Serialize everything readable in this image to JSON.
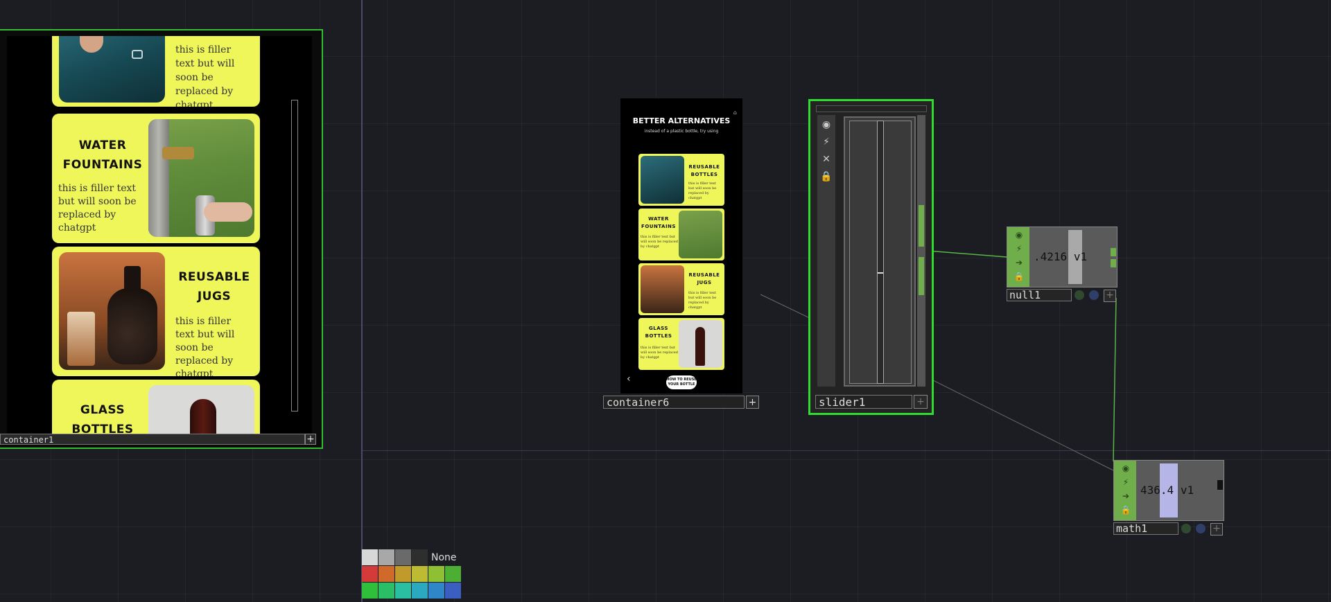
{
  "container1": {
    "label": "container1",
    "cards": [
      {
        "title": "",
        "body": "this is filler text but will soon be replaced by chatgpt"
      },
      {
        "title": "WATER FOUNTAINS",
        "body": "this is filler text but will soon be replaced by chatgpt"
      },
      {
        "title": "REUSABLE JUGS",
        "body": "this is filler text but will soon be replaced by chatgpt"
      },
      {
        "title": "GLASS BOTTLES",
        "body": ""
      }
    ]
  },
  "container6": {
    "label": "container6",
    "heading": "BETTER ALTERNATIVES",
    "subheading": "instead of a plastic bottle, try using",
    "cards": [
      {
        "title": "REUSABLE BOTTLES",
        "body": "this is filler text but will soon be replaced by chatgpt"
      },
      {
        "title": "WATER FOUNTAINS",
        "body": "this is filler text but will soon be replaced by chatgpt"
      },
      {
        "title": "REUSABLE JUGS",
        "body": "this is filler text but will soon be replaced by chatgpt"
      },
      {
        "title": "GLASS BOTTLES",
        "body": "this is filler text but will soon be replaced by chatgpt"
      }
    ],
    "back_icon": "‹",
    "cta": "HOW TO REUSE YOUR BOTTLE"
  },
  "slider1": {
    "label": "slider1",
    "level": 0.42
  },
  "null1": {
    "label": "null1",
    "value": ".4216",
    "channel": "v1"
  },
  "math1": {
    "label": "math1",
    "value": "436.4",
    "channel": "v1"
  },
  "palette": {
    "none_label": "None",
    "colors": [
      "#d8d8d8",
      "#a8a8a8",
      "#6a6a6a",
      "#2e2e2e",
      "#d53a3a",
      "#d06a2a",
      "#c09a2a",
      "#bdbb32",
      "#8fbf32",
      "#4caf34",
      "#2fbf3a",
      "#2abf66",
      "#2abfa3",
      "#2aa9c0",
      "#2f86c8",
      "#3a5fc0"
    ],
    "accent": "#2fdc2f"
  }
}
